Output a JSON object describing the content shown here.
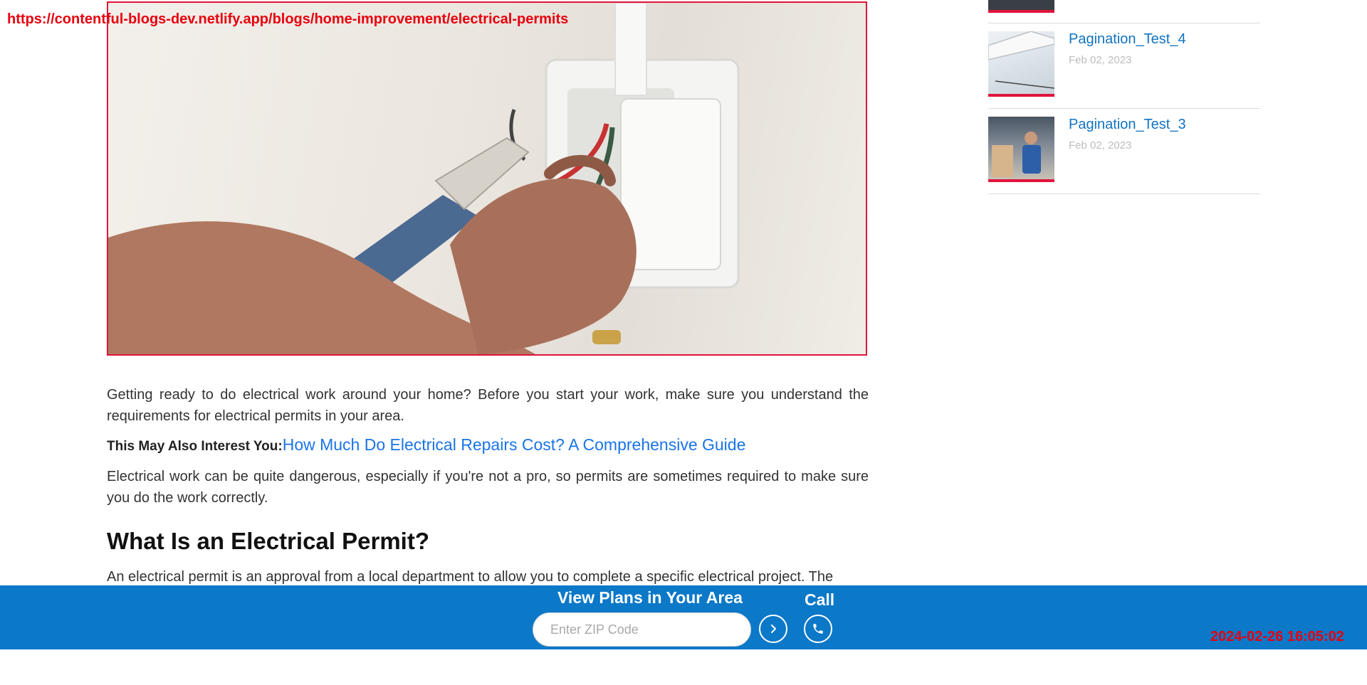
{
  "overlay": {
    "url": "https://contentful-blogs-dev.netlify.app/blogs/home-improvement/electrical-permits",
    "timestamp": "2024-02-26 16:05:02"
  },
  "article": {
    "hero_image": "electrician-wiring-outlet-photo",
    "p1": "Getting ready to do electrical work around your home? Before you start your work, make sure you understand the requirements for electrical permits in your area.",
    "interest_label": "This May Also Interest You:",
    "interest_link": "How Much Do Electrical Repairs Cost? A Comprehensive Guide",
    "p2": "Electrical work can be quite dangerous, especially if you're not a pro, so permits are sometimes required to make sure you do the work correctly.",
    "heading": "What Is an Electrical Permit?",
    "p3": "An electrical permit is an approval from a local department to allow you to complete a specific electrical project. The"
  },
  "sidebar": {
    "items": [
      {
        "title": "Pagination_Test_4",
        "date": "Feb 02, 2023"
      },
      {
        "title": "Pagination_Test_3",
        "date": "Feb 02, 2023"
      }
    ]
  },
  "bottom_bar": {
    "title": "View Plans in Your Area",
    "zip_placeholder": "Enter ZIP Code",
    "call_label": "Call",
    "colors": {
      "bar": "#0b78c8",
      "accent": "#e0143c"
    }
  }
}
